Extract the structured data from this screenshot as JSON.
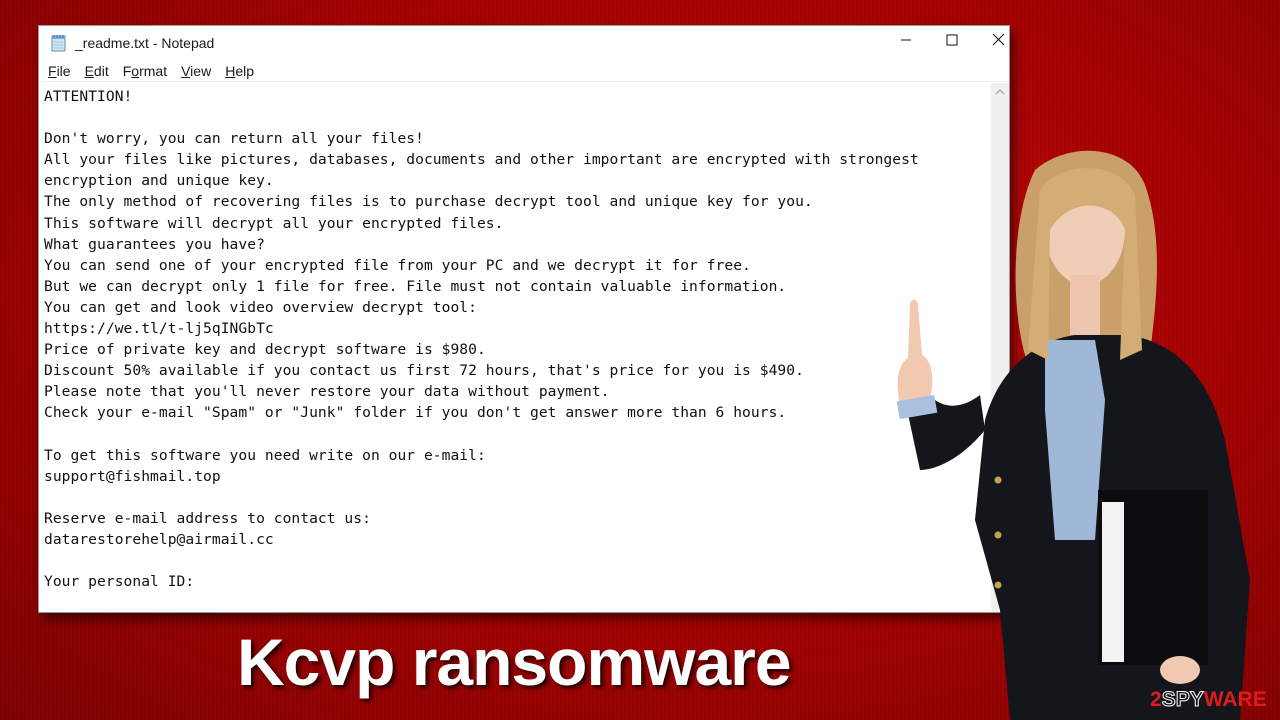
{
  "window": {
    "title": "_readme.txt - Notepad",
    "app_icon": "notepad-icon",
    "controls": {
      "minimize": "minimize-icon",
      "maximize": "maximize-icon",
      "close": "close-icon"
    }
  },
  "menu": [
    {
      "accel": "F",
      "rest": "ile"
    },
    {
      "accel": "E",
      "rest": "dit"
    },
    {
      "pre": "F",
      "accel": "o",
      "rest": "rmat"
    },
    {
      "accel": "V",
      "rest": "iew"
    },
    {
      "accel": "H",
      "rest": "elp"
    }
  ],
  "menu_labels": [
    "File",
    "Edit",
    "Format",
    "View",
    "Help"
  ],
  "document": {
    "lines": [
      "ATTENTION!",
      "",
      "Don't worry, you can return all your files!",
      "All your files like pictures, databases, documents and other important are encrypted with strongest",
      "encryption and unique key.",
      "The only method of recovering files is to purchase decrypt tool and unique key for you.",
      "This software will decrypt all your encrypted files.",
      "What guarantees you have?",
      "You can send one of your encrypted file from your PC and we decrypt it for free.",
      "But we can decrypt only 1 file for free. File must not contain valuable information.",
      "You can get and look video overview decrypt tool:",
      "https://we.tl/t-lj5qINGbTc",
      "Price of private key and decrypt software is $980.",
      "Discount 50% available if you contact us first 72 hours, that's price for you is $490.",
      "Please note that you'll never restore your data without payment.",
      "Check your e-mail \"Spam\" or \"Junk\" folder if you don't get answer more than 6 hours.",
      "",
      "To get this software you need write on our e-mail:",
      "support@fishmail.top",
      "",
      "Reserve e-mail address to contact us:",
      "datarestorehelp@airmail.cc",
      "",
      "Your personal ID:"
    ]
  },
  "scrollbar": {
    "up_icon": "chevron-up-icon"
  },
  "headline": "Kcvp ransomware",
  "logo": {
    "num": "2",
    "spy": "SPY",
    "ware": "WARE"
  },
  "colors": {
    "background_red": "#a30000",
    "logo_red": "#e01b1b",
    "window_bg": "#ffffff",
    "text": "#111111"
  }
}
